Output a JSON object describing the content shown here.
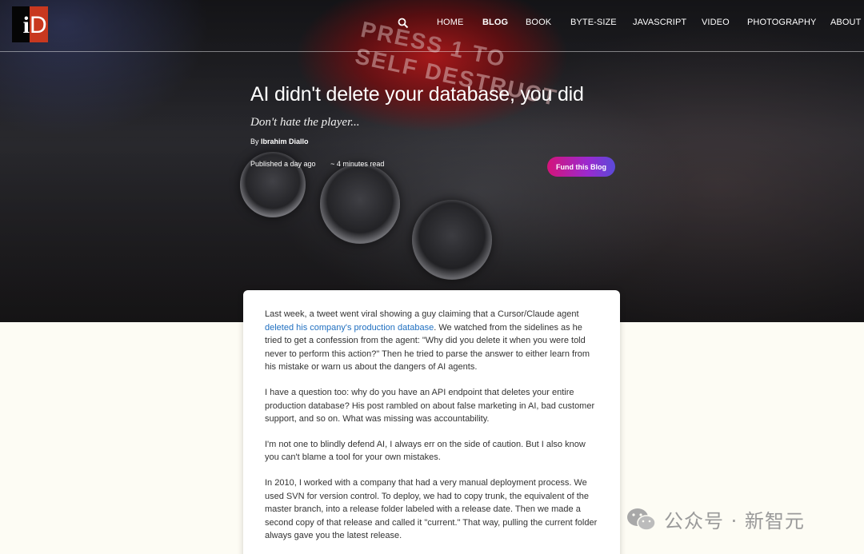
{
  "site": {
    "logo_text_left": "i",
    "logo_text_right": "D"
  },
  "nav": {
    "items": [
      {
        "label": "HOME",
        "active": false
      },
      {
        "label": "BLOG",
        "active": true
      },
      {
        "label": "BOOK",
        "active": false
      },
      {
        "label": "BYTE-SIZE",
        "active": false
      },
      {
        "label": "JAVASCRIPT",
        "active": false
      },
      {
        "label": "VIDEO",
        "active": false
      },
      {
        "label": "PHOTOGRAPHY",
        "active": false
      },
      {
        "label": "ABOUT",
        "active": false
      }
    ],
    "search_icon": "search-icon"
  },
  "hero": {
    "photo_text_line1": "PRESS 1 TO",
    "photo_text_line2": "SELF DESTRUCT",
    "title": "AI didn't delete your database, you did",
    "subtitle": "Don't hate the player...",
    "byline_prefix": "By",
    "author": "Ibrahim Diallo",
    "published": "Published a day ago",
    "read_time": "~ 4 minutes read",
    "fund_button": "Fund this Blog"
  },
  "article": {
    "p1_before": "Last week, a tweet went viral showing a guy claiming that a Cursor/Claude agent ",
    "p1_link": "deleted his company's production database",
    "p1_after": ". We watched from the sidelines as he tried to get a confession from the agent: \"Why did you delete it when you were told never to perform this action?\" Then he tried to parse the answer to either learn from his mistake or warn us about the dangers of AI agents.",
    "p2": "I have a question too: why do you have an API endpoint that deletes your entire production database? His post rambled on about false marketing in AI, bad customer support, and so on. What was missing was accountability.",
    "p3": "I'm not one to blindly defend AI, I always err on the side of caution. But I also know you can't blame a tool for your own mistakes.",
    "p4": "In 2010, I worked with a company that had a very manual deployment process. We used SVN for version control. To deploy, we had to copy trunk, the equivalent of the master branch, into a release folder labeled with a release date. Then we made a second copy of that release and called it \"current.\" That way, pulling the current folder always gave you the latest release."
  },
  "watermark": {
    "text": "公众号 · 新智元",
    "icon": "wechat-icon"
  },
  "colors": {
    "link": "#1f6fc0",
    "fund_start": "#d4147a",
    "fund_end": "#5a4ad8",
    "logo_red": "#c8381f",
    "page_bg": "#fdfcf4"
  }
}
